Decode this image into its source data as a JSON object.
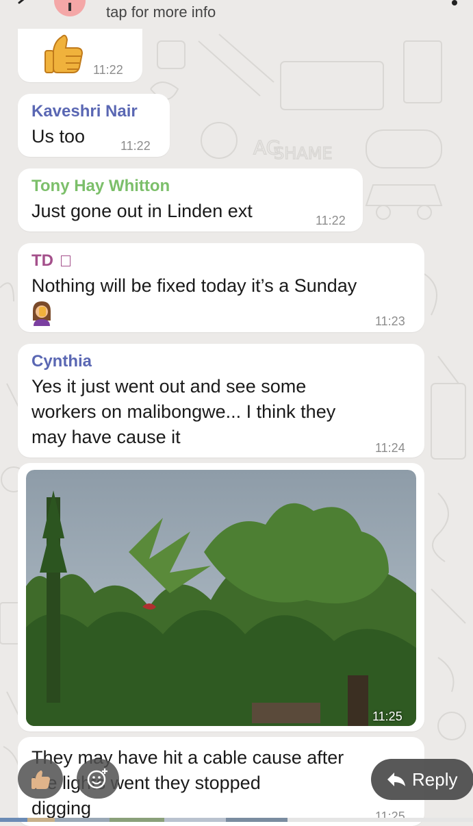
{
  "header": {
    "subtitle": "tap for more info"
  },
  "messages": [
    {
      "emoji": "thumbs-up",
      "time": "11:22"
    },
    {
      "sender": "Kaveshri Nair",
      "sender_color": "#5a67b3",
      "text": "Us too",
      "time": "11:22"
    },
    {
      "sender": "Tony Hay Whitton",
      "sender_color": "#7cbf6a",
      "text": "Just gone out in Linden ext",
      "time": "11:22"
    },
    {
      "sender": "TD",
      "sender_color": "#a4508b",
      "text": "Nothing will be fixed today it’s a Sunday",
      "emoji": "woman-facepalming",
      "time": "11:23"
    },
    {
      "sender": "Cynthia",
      "sender_color": "#5a67b3",
      "text": "Yes it just went out and see some\nworkers on malibongwe... I think they\nmay have cause it",
      "time": "11:24"
    },
    {
      "image": "photo-trees",
      "time": "11:25"
    },
    {
      "text": "They may have hit a cable cause after\nthe lights went they stopped\ndigging",
      "time": "11:25"
    }
  ],
  "bottom_bar": {
    "reply_label": "Reply"
  },
  "colors": {
    "background": "#eceae8",
    "bubble": "#ffffff",
    "timestamp": "#8c8c8c",
    "reply_pill": "#4a4a4a"
  }
}
